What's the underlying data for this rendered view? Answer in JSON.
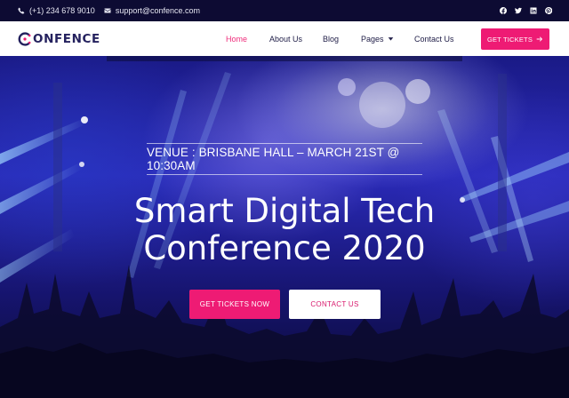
{
  "topbar": {
    "phone": "(+1) 234 678 9010",
    "email": "support@confence.com",
    "socials": [
      {
        "icon": "facebook-icon"
      },
      {
        "icon": "twitter-icon"
      },
      {
        "icon": "linkedin-icon"
      },
      {
        "icon": "pinterest-icon"
      }
    ]
  },
  "header": {
    "logo_text": "ONFENCE",
    "nav": {
      "home": "Home",
      "about": "About Us",
      "blog": "Blog",
      "pages": "Pages",
      "contact": "Contact Us"
    },
    "tickets_button": "GET TICKETS"
  },
  "hero": {
    "venue": "VENUE : BRISBANE HALL – MARCH 21ST @ 10:30AM",
    "title_line1": "Smart Digital Tech",
    "title_line2": "Conference 2020",
    "primary_button": "GET TICKETS NOW",
    "secondary_button": "CONTACT US"
  },
  "colors": {
    "accent": "#ee1b74",
    "topbar_bg": "#0d0b33",
    "nav_text": "#23214a",
    "logo_text": "#24215e"
  }
}
